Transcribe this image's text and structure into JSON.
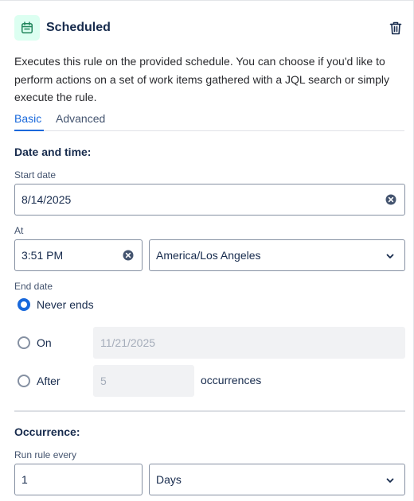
{
  "header": {
    "title": "Scheduled",
    "icon": "calendar-icon",
    "delete_icon": "trash-icon"
  },
  "description": "Executes this rule on the provided schedule. You can choose if you'd like to perform actions on a set of work items gathered with a JQL search or simply execute the rule.",
  "tabs": [
    {
      "label": "Basic",
      "active": true
    },
    {
      "label": "Advanced",
      "active": false
    }
  ],
  "date_time": {
    "heading": "Date and time:",
    "start_date": {
      "label": "Start date",
      "value": "8/14/2025"
    },
    "at": {
      "label": "At",
      "time": "3:51 PM",
      "timezone": "America/Los Angeles"
    }
  },
  "end_date": {
    "label": "End date",
    "options": [
      {
        "label": "Never ends",
        "selected": true
      },
      {
        "label": "On",
        "selected": false,
        "value": "11/21/2025"
      },
      {
        "label": "After",
        "selected": false,
        "value": "5",
        "suffix": "occurrences"
      }
    ]
  },
  "occurrence": {
    "heading": "Occurrence:",
    "run_rule_every": {
      "label": "Run rule every",
      "value": "1",
      "unit": "Days"
    }
  },
  "colors": {
    "accent": "#1868db",
    "icon_bg": "#dcfff1",
    "icon_fg": "#1f845a",
    "text": "#172b4d",
    "border": "#8590a2"
  }
}
